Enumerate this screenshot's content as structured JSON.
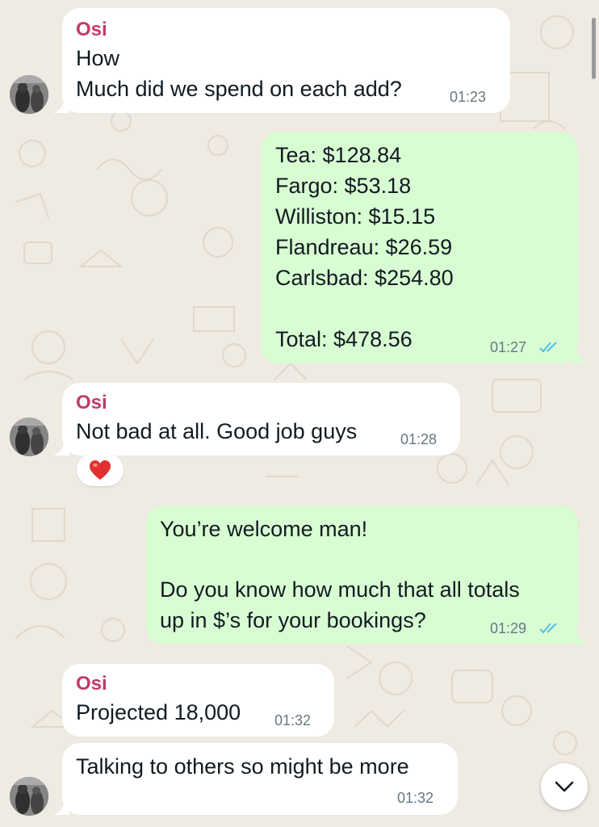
{
  "colors": {
    "background": "#efeae2",
    "incoming_bubble": "#ffffff",
    "outgoing_bubble": "#d9fdd3",
    "sender_name": "#c13a6a",
    "timestamp": "#667781",
    "read_ticks": "#53bdeb"
  },
  "messages": [
    {
      "direction": "incoming",
      "sender": "Osi",
      "lines": [
        "How",
        "Much did we spend on each add?"
      ],
      "time": "01:23"
    },
    {
      "direction": "outgoing",
      "lines": [
        "Tea: $128.84",
        "Fargo: $53.18",
        "Williston: $15.15",
        "Flandreau: $26.59",
        "Carlsbad: $254.80",
        "",
        "Total: $478.56"
      ],
      "time": "01:27",
      "status": "read"
    },
    {
      "direction": "incoming",
      "sender": "Osi",
      "lines": [
        "Not bad at all. Good job guys"
      ],
      "time": "01:28",
      "reaction": "heart-emoji"
    },
    {
      "direction": "outgoing",
      "lines": [
        "You’re welcome man!",
        "",
        "Do you know how much that all totals",
        "up in $’s for your bookings?"
      ],
      "time": "01:29",
      "status": "read"
    },
    {
      "direction": "incoming",
      "sender": "Osi",
      "lines": [
        "Projected 18,000"
      ],
      "time": "01:32"
    },
    {
      "direction": "incoming",
      "lines": [
        "Talking to others so might be more"
      ],
      "time": "01:32"
    }
  ],
  "scroll_button": {
    "icon": "chevron-down-icon"
  }
}
